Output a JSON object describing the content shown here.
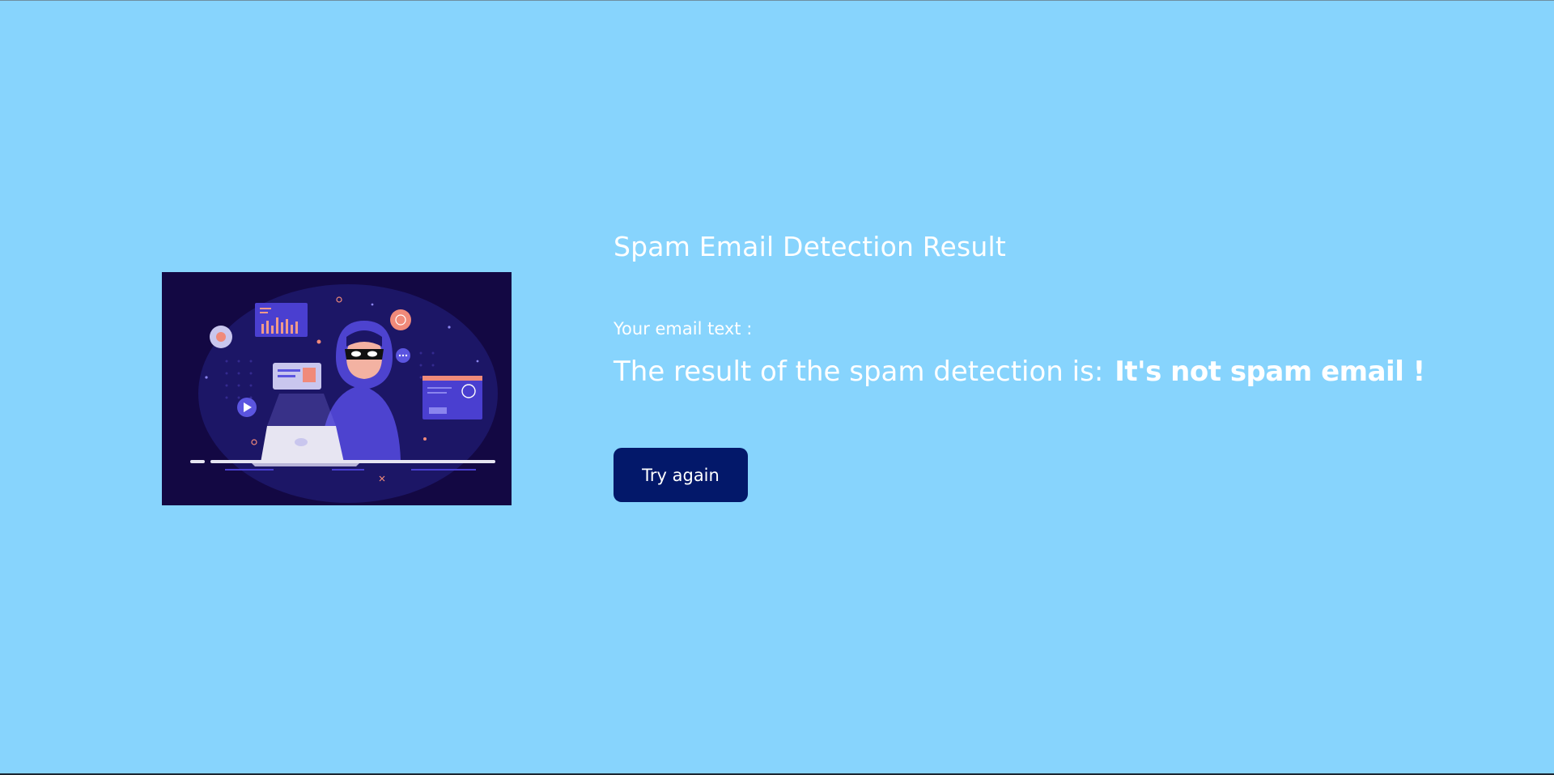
{
  "header": {
    "title": "Spam Email Detection Result"
  },
  "main": {
    "email_label": "Your email text :",
    "result_prefix": "The result of the spam detection is:",
    "result_value": "It's not spam email !",
    "try_again_label": "Try again"
  },
  "illustration": {
    "icon": "hacker-laptop-illustration"
  },
  "colors": {
    "background": "#87d4fd",
    "button": "#03186a",
    "text": "#ffffff",
    "illustration_bg": "#130843"
  }
}
